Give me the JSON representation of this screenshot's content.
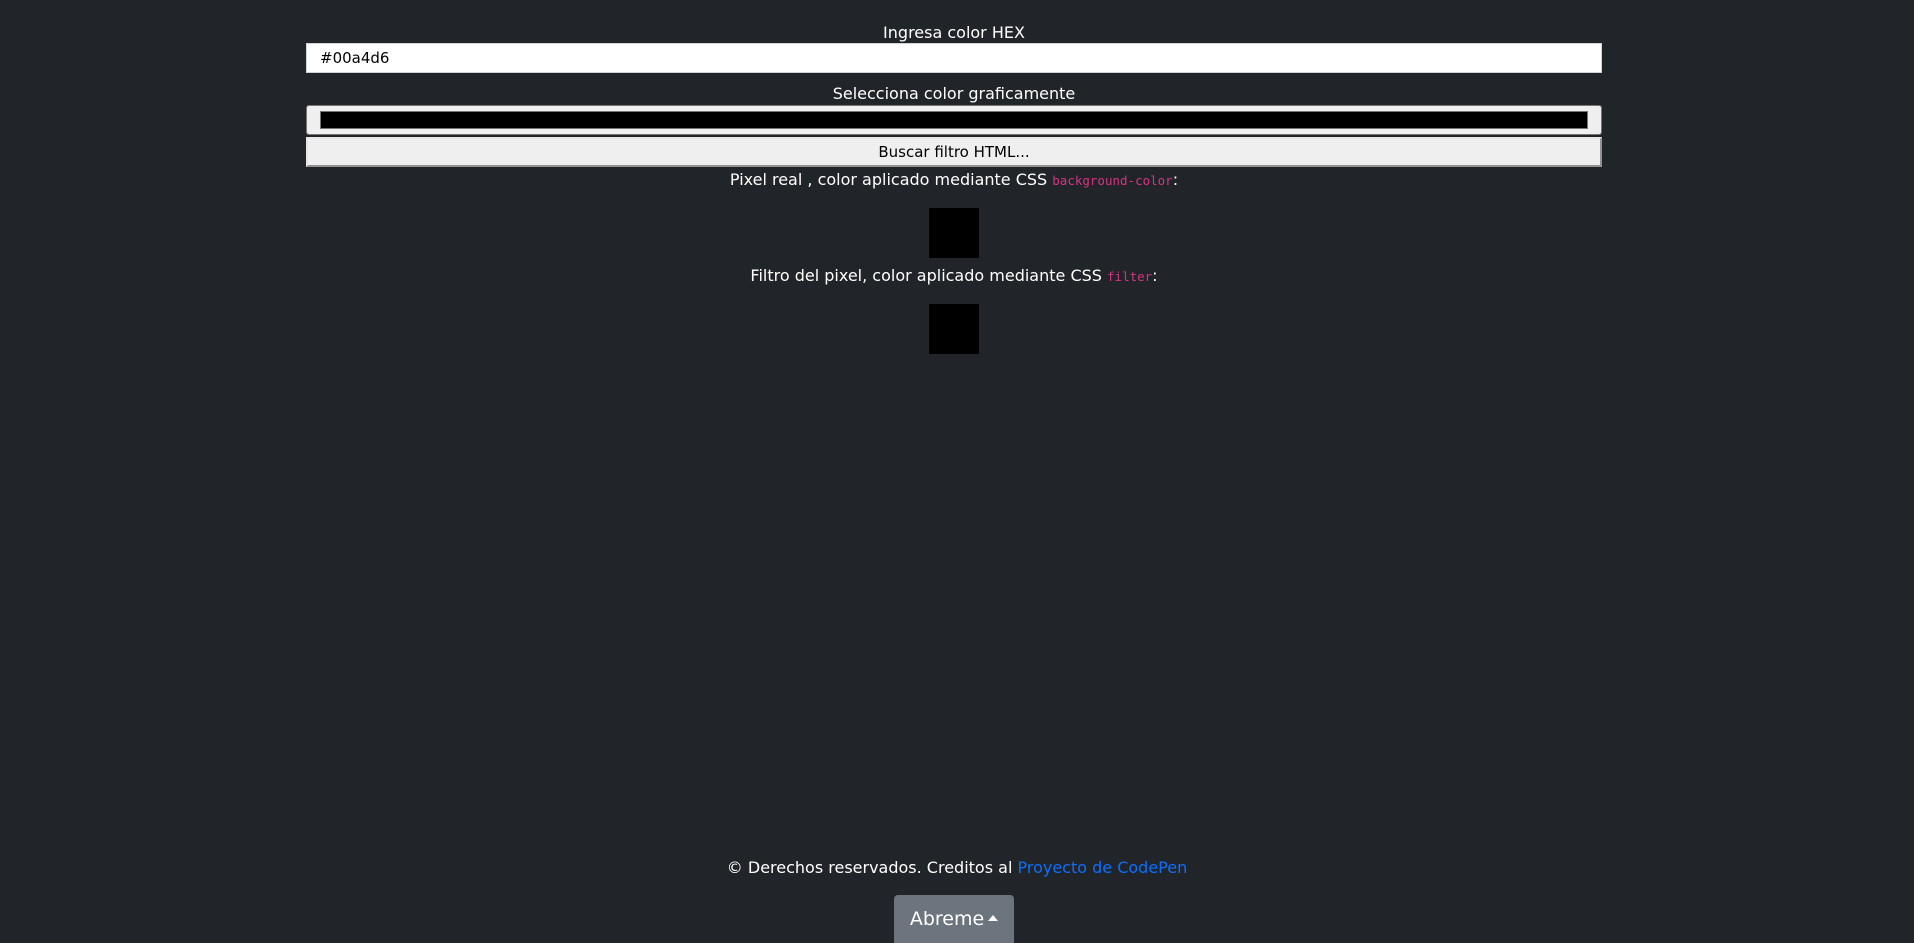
{
  "form": {
    "hex_label": "Ingresa color HEX",
    "hex_value": "#00a4d6",
    "graphic_label": "Selecciona color graficamente",
    "picker_color": "#000000",
    "search_button_label": "Buscar filtro HTML..."
  },
  "results": {
    "real_label_text": "Pixel real , color aplicado mediante CSS ",
    "real_label_code": "background-color",
    "real_label_suffix": ":",
    "real_pixel_color": "#000000",
    "filter_label_text": "Filtro del pixel, color aplicado mediante CSS ",
    "filter_label_code": "filter",
    "filter_label_suffix": ":",
    "filter_pixel_color": "#000000"
  },
  "footer": {
    "text": "© Derechos reservados. Creditos al ",
    "link_text": "Proyecto de CodePen",
    "open_button_label": "Abreme"
  },
  "colors": {
    "background": "#212529",
    "link": "#0d6efd",
    "code": "#d63384",
    "button_secondary": "#6c757d"
  },
  "icons": {
    "open_button_icon": "caret-up-icon"
  }
}
